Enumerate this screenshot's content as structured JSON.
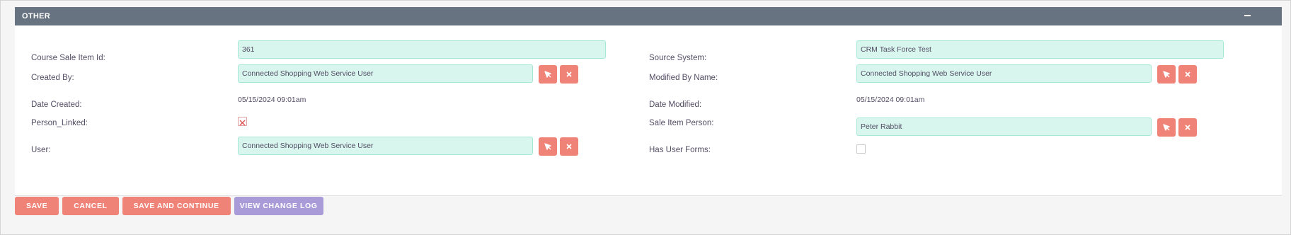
{
  "panel": {
    "title": "OTHER",
    "collapse_icon": "minus-icon"
  },
  "left": {
    "course_sale_item_id": {
      "label": "Course Sale Item Id:",
      "value": "361"
    },
    "created_by": {
      "label": "Created By:",
      "value": "Connected Shopping Web Service User"
    },
    "date_created": {
      "label": "Date Created:",
      "value": "05/15/2024 09:01am"
    },
    "person_linked": {
      "label": "Person_Linked:",
      "checked": true
    },
    "user": {
      "label": "User:",
      "value": "Connected Shopping Web Service User"
    }
  },
  "right": {
    "source_system": {
      "label": "Source System:",
      "value": "CRM Task Force Test"
    },
    "modified_by_name": {
      "label": "Modified By Name:",
      "value": "Connected Shopping Web Service User"
    },
    "date_modified": {
      "label": "Date Modified:",
      "value": "05/15/2024 09:01am"
    },
    "sale_item_person": {
      "label": "Sale Item Person:",
      "value": "Peter Rabbit"
    },
    "has_user_forms": {
      "label": "Has User Forms:",
      "checked": false
    }
  },
  "actions": {
    "save": "SAVE",
    "cancel": "CANCEL",
    "save_continue": "SAVE AND CONTINUE",
    "view_change_log": "VIEW CHANGE LOG"
  },
  "colors": {
    "header_bg": "#677380",
    "field_bg": "#d8f5ee",
    "accent_button": "#f08377",
    "secondary_button": "#a99ad8"
  }
}
